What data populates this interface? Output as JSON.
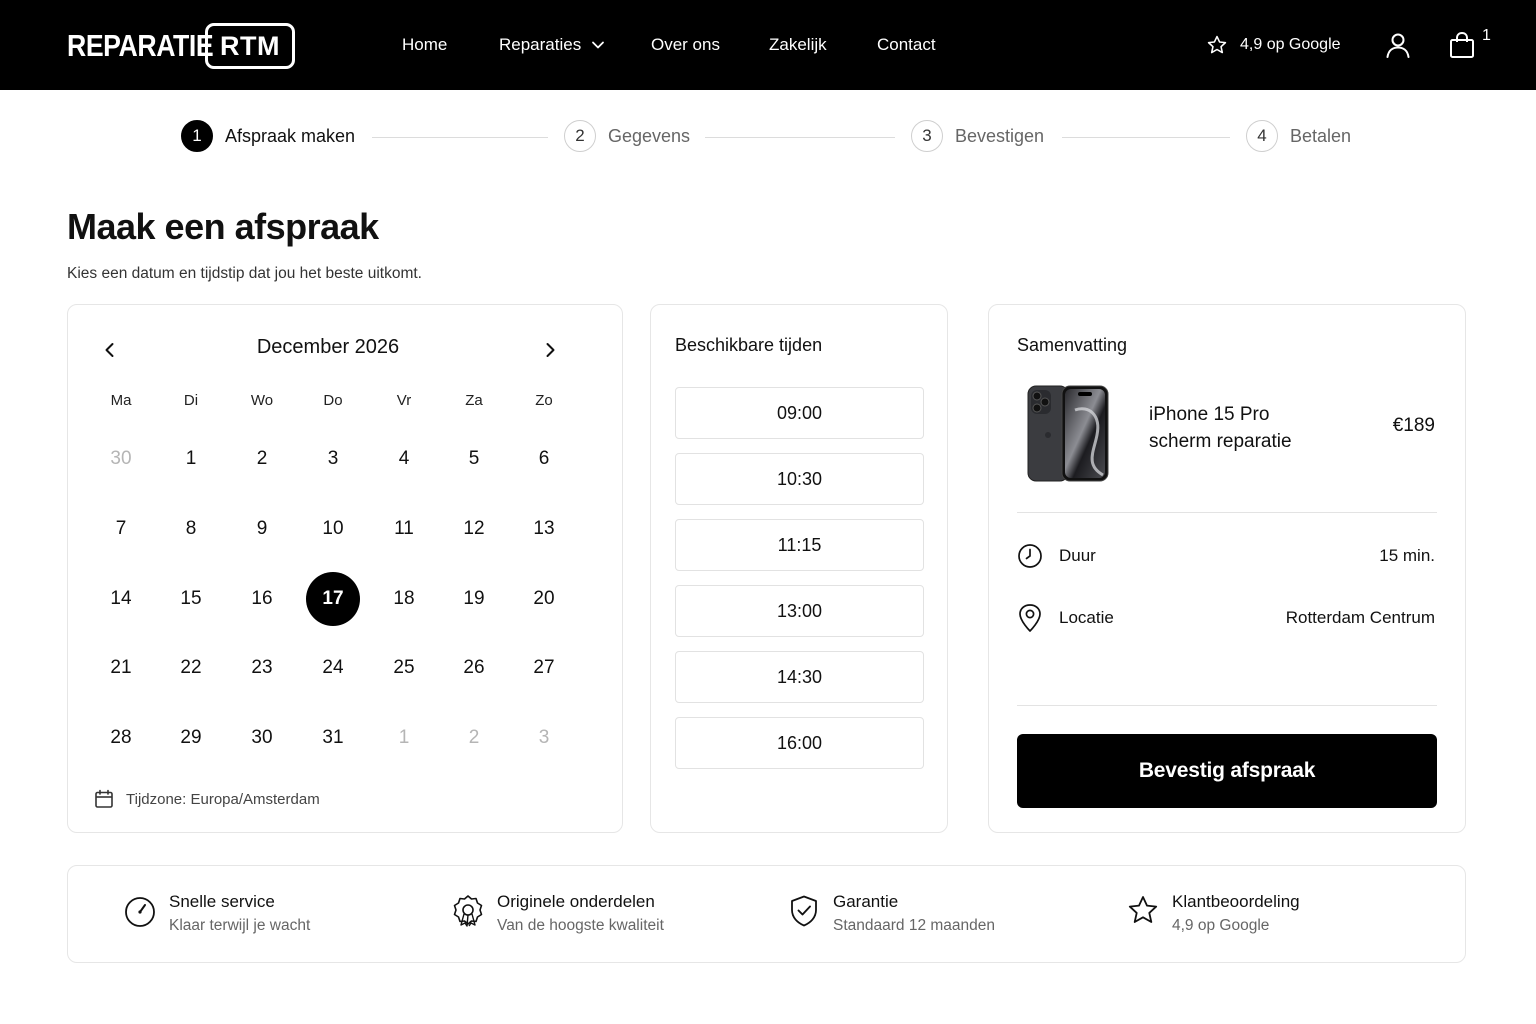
{
  "header": {
    "logo_word": "REPARATIE",
    "logo_box": "RTM",
    "nav": [
      {
        "label": "Home"
      },
      {
        "label": "Reparaties"
      },
      {
        "label": "Over ons"
      },
      {
        "label": "Zakelijk"
      },
      {
        "label": "Contact"
      }
    ],
    "rating_text": "4,9 op Google",
    "cart_count": "1"
  },
  "stepper": [
    {
      "num": "1",
      "label": "Afspraak maken",
      "active": true
    },
    {
      "num": "2",
      "label": "Gegevens",
      "active": false
    },
    {
      "num": "3",
      "label": "Bevestigen",
      "active": false
    },
    {
      "num": "4",
      "label": "Betalen",
      "active": false
    }
  ],
  "page": {
    "title": "Maak een afspraak",
    "subtitle": "Kies een datum en tijdstip dat jou het beste uitkomt."
  },
  "calendar": {
    "month_label": "December 2026",
    "weekdays": [
      "Ma",
      "Di",
      "Wo",
      "Do",
      "Vr",
      "Za",
      "Zo"
    ],
    "weeks": [
      [
        {
          "d": "30",
          "muted": true
        },
        {
          "d": "1"
        },
        {
          "d": "2"
        },
        {
          "d": "3"
        },
        {
          "d": "4"
        },
        {
          "d": "5"
        },
        {
          "d": "6"
        }
      ],
      [
        {
          "d": "7"
        },
        {
          "d": "8"
        },
        {
          "d": "9"
        },
        {
          "d": "10"
        },
        {
          "d": "11"
        },
        {
          "d": "12"
        },
        {
          "d": "13"
        }
      ],
      [
        {
          "d": "14"
        },
        {
          "d": "15"
        },
        {
          "d": "16"
        },
        {
          "d": "17",
          "selected": true
        },
        {
          "d": "18"
        },
        {
          "d": "19"
        },
        {
          "d": "20"
        }
      ],
      [
        {
          "d": "21"
        },
        {
          "d": "22"
        },
        {
          "d": "23"
        },
        {
          "d": "24"
        },
        {
          "d": "25"
        },
        {
          "d": "26"
        },
        {
          "d": "27"
        }
      ],
      [
        {
          "d": "28"
        },
        {
          "d": "29"
        },
        {
          "d": "30"
        },
        {
          "d": "31"
        },
        {
          "d": "1",
          "muted": true
        },
        {
          "d": "2",
          "muted": true
        },
        {
          "d": "3",
          "muted": true
        }
      ]
    ],
    "timezone": "Tijdzone: Europa/Amsterdam"
  },
  "times": {
    "title": "Beschikbare tijden",
    "slots": [
      "09:00",
      "10:30",
      "11:15",
      "13:00",
      "14:30",
      "16:00"
    ]
  },
  "summary": {
    "title": "Samenvatting",
    "product_line1": "iPhone 15 Pro",
    "product_line2": "scherm reparatie",
    "price": "€189",
    "duration_label": "Duur",
    "duration_value": "15 min.",
    "location_label": "Locatie",
    "location_value": "Rotterdam Centrum",
    "confirm_label": "Bevestig afspraak"
  },
  "features": [
    {
      "title": "Snelle service",
      "sub": "Klaar terwijl je wacht",
      "icon": "speedometer-icon"
    },
    {
      "title": "Originele onderdelen",
      "sub": "Van de hoogste kwaliteit",
      "icon": "quality-badge-icon"
    },
    {
      "title": "Garantie",
      "sub": "Standaard 12 maanden",
      "icon": "shield-check-icon"
    },
    {
      "title": "Klantbeoordeling",
      "sub": "4,9 op Google",
      "icon": "star-icon"
    }
  ],
  "colors": {
    "header_bg": "#000000",
    "accent": "#000000",
    "muted_text": "#b5b5b5",
    "border": "#e6e6e6"
  }
}
